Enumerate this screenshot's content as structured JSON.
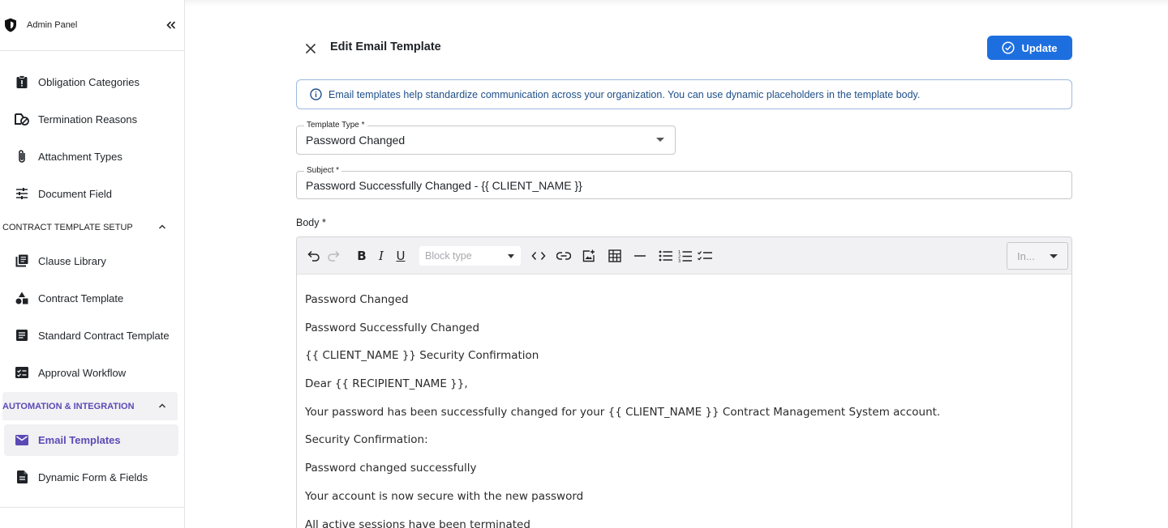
{
  "sidebar": {
    "header_title": "Admin Panel",
    "items_top": [
      {
        "label": "Obligation Categories",
        "icon": "clipboard-icon"
      },
      {
        "label": "Termination Reasons",
        "icon": "no-entry-icon"
      },
      {
        "label": "Attachment Types",
        "icon": "paperclip-icon"
      },
      {
        "label": "Document Field",
        "icon": "sliders-icon"
      }
    ],
    "section_contract": "CONTRACT TEMPLATE SETUP",
    "items_contract": [
      {
        "label": "Clause Library",
        "icon": "library-icon"
      },
      {
        "label": "Contract Template",
        "icon": "shapes-icon"
      },
      {
        "label": "Standard Contract Template",
        "icon": "article-icon"
      },
      {
        "label": "Approval Workflow",
        "icon": "checklist-icon"
      }
    ],
    "section_automation": "AUTOMATION & INTEGRATION",
    "items_automation": [
      {
        "label": "Email Templates",
        "icon": "mail-icon"
      },
      {
        "label": "Dynamic Form & Fields",
        "icon": "description-icon"
      }
    ]
  },
  "main": {
    "title": "Edit Email Template",
    "update_label": "Update",
    "info_text": "Email templates help standardize communication across your organization. You can use dynamic placeholders in the template body.",
    "template_type": {
      "label": "Template Type *",
      "value": "Password Changed"
    },
    "subject": {
      "label": "Subject *",
      "value": "Password Successfully Changed - {{ CLIENT_NAME }}"
    },
    "body_label": "Body *",
    "editor": {
      "block_type_placeholder": "Block type",
      "insert_placeholder": "In...",
      "lines": [
        "Password Changed",
        "Password Successfully Changed",
        "{{ CLIENT_NAME }} Security Confirmation",
        "Dear {{ RECIPIENT_NAME }},",
        "Your password has been successfully changed for your {{ CLIENT_NAME }} Contract Management System account.",
        "Security Confirmation:",
        "Password changed successfully",
        "Your account is now secure with the new password",
        "All active sessions have been terminated"
      ]
    }
  },
  "colors": {
    "accent": "#1d6fe0",
    "active_nav": "#5b4ab6",
    "info_text": "#1f4f8a",
    "info_border": "#9db9de"
  }
}
